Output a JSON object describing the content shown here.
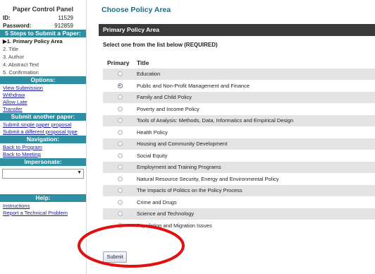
{
  "sidebar": {
    "panel_title": "Paper Control Panel",
    "id_label": "ID:",
    "id_value": "11529",
    "password_label": "Password:",
    "password_value": "912859",
    "steps_heading": "5 Steps to Submit a Paper:",
    "steps": [
      {
        "label": "▶1. Primary Policy Area",
        "current": true
      },
      {
        "label": "2. Title",
        "current": false
      },
      {
        "label": "3. Author",
        "current": false
      },
      {
        "label": "4. Abstract Text",
        "current": false
      },
      {
        "label": "5. Confirmation",
        "current": false
      }
    ],
    "options_heading": "Options:",
    "options": [
      "View Submission",
      "Withdraw",
      "Allow Late",
      "Transfer"
    ],
    "submit_another_heading": "Submit another paper:",
    "submit_another": [
      "Submit single paper proposal",
      "Submit a different proposal type"
    ],
    "navigation_heading": "Navigation:",
    "navigation": [
      "Back to Program",
      "Back to Meeting"
    ],
    "impersonate_heading": "Impersonate:",
    "impersonate_value": "",
    "help_heading": "Help:",
    "help": [
      "Instructions",
      "Report a Technical Problem"
    ]
  },
  "main": {
    "page_title": "Choose Policy Area",
    "section_title": "Primary Policy Area",
    "instruction": "Select one from the list below (REQUIRED)",
    "col_primary": "Primary",
    "col_title": "Title",
    "rows": [
      {
        "title": "Education",
        "selected": false
      },
      {
        "title": "Public and Non-Profit Management and Finance",
        "selected": true
      },
      {
        "title": "Family and Child Policy",
        "selected": false
      },
      {
        "title": "Poverty and Income Policy",
        "selected": false
      },
      {
        "title": "Tools of Analysis: Methods, Data, Informatics and Empirical Design",
        "selected": false
      },
      {
        "title": "Health Policy",
        "selected": false
      },
      {
        "title": "Housing and Community Development",
        "selected": false
      },
      {
        "title": "Social Equity",
        "selected": false
      },
      {
        "title": "Employment and Training Programs",
        "selected": false
      },
      {
        "title": "Natural Resource Security, Energy and Environmental Policy",
        "selected": false
      },
      {
        "title": "The Impacts of Politics on the Policy Process",
        "selected": false
      },
      {
        "title": "Crime and Drugs",
        "selected": false
      },
      {
        "title": "Science and Technology",
        "selected": false
      },
      {
        "title": "Population and Migration Issues",
        "selected": false
      }
    ],
    "submit_label": "Submit"
  },
  "colors": {
    "sidebar_heading": "#2e8fa3",
    "page_title": "#1a6a82",
    "section_bar": "#3a3a3a",
    "annotation_circle": "#e01010"
  }
}
